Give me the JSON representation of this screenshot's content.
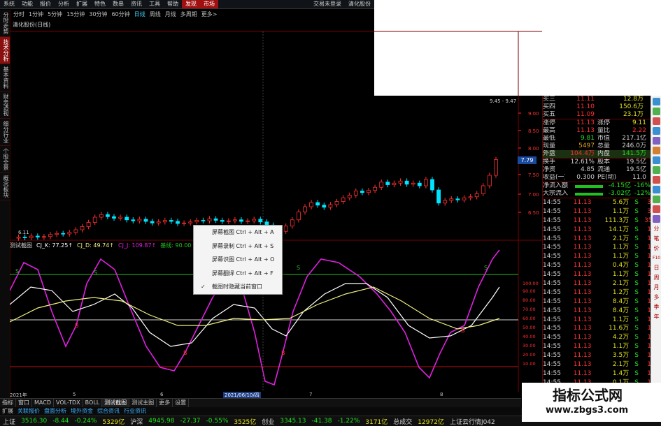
{
  "menubar": {
    "items": [
      "系统",
      "功能",
      "报价",
      "分析",
      "扩展",
      "特色",
      "数串",
      "资讯",
      "工具",
      "帮助"
    ],
    "highlight": [
      "发现",
      "市场"
    ],
    "right_items": [
      "交易未登录",
      "清化股份"
    ]
  },
  "toolbar": {
    "items": [
      "分时",
      "1分钟",
      "5分钟",
      "15分钟",
      "30分钟",
      "60分钟",
      "日线",
      "周线",
      "月线",
      "多周期",
      "更多>"
    ],
    "active": "日线"
  },
  "left_tabs": [
    "分时走势",
    "技术分析",
    "基本资料",
    "财务透视",
    "细分行业",
    "个股全景",
    "概念板块"
  ],
  "left_tab_active": "技术分析",
  "stock_title": "清化股份(日线)",
  "chart": {
    "upper_ticks": [
      "9.00",
      "8.50",
      "8.00",
      "7.50",
      "7.00",
      "6.50"
    ],
    "high_label": "9.45 - 9.47",
    "low_label": "6.11",
    "price_tag": "7.79",
    "lower_ticks": [
      "100.00",
      "90.00",
      "80.00",
      "70.00",
      "60.00",
      "50.00",
      "40.00",
      "30.00",
      "20.00",
      "10.00"
    ],
    "s_labels": [
      "S",
      "S",
      "S",
      "S",
      "S"
    ],
    "b_labels": [
      "B",
      "B",
      "B",
      "B",
      "B"
    ],
    "date_labels": [
      "2021年",
      "5",
      "6",
      "2021/06/10/四",
      "7",
      "8"
    ]
  },
  "indicator_bar": {
    "name": "测试截图",
    "k": "CJ_K: 77.25↑",
    "d": "CJ_D: 49.74↑",
    "j": "CJ_J: 109.87↑",
    "extra": "基线: 90.00"
  },
  "context_menu": {
    "items": [
      "屏幕截图 Ctrl + Alt + A",
      "屏幕录制 Ctrl + Alt + S",
      "屏幕识图 Ctrl + Alt + O",
      "屏幕翻译 Ctrl + Alt + F",
      "截图时隐藏当前窗口"
    ],
    "checked_index": 4
  },
  "quote": {
    "rows": [
      {
        "label": "买三",
        "value": "11.11",
        "side": "12.8万"
      },
      {
        "label": "买四",
        "value": "11.10",
        "side": "150.6万"
      },
      {
        "label": "买五",
        "value": "11.09",
        "side": "23.1万"
      }
    ],
    "stats": [
      {
        "l1": "涨停",
        "v1": "11.13",
        "l2": "涨停",
        "v2": "9.11"
      },
      {
        "l1": "最高",
        "v1": "11.13",
        "l2": "量比",
        "v2": "2.22"
      },
      {
        "l1": "最低",
        "v1": "9.81",
        "l2": "市值",
        "v2": "217.1亿"
      },
      {
        "l1": "现量",
        "v1": "5497",
        "l2": "总量",
        "v2": "246.0万"
      },
      {
        "l1": "外盘",
        "v1": "104.4万",
        "l2": "内盘",
        "v2": "141.5万"
      },
      {
        "l1": "换手",
        "v1": "12.61%",
        "l2": "股本",
        "v2": "19.5亿"
      },
      {
        "l1": "净资",
        "v1": "4.85",
        "l2": "流通",
        "v2": "19.5亿"
      },
      {
        "l1": "收益(一)",
        "v1": "0.300",
        "l2": "PE(动)",
        "v2": "11.0"
      }
    ],
    "flows": [
      {
        "label": "净流入额",
        "value": "-4.15亿",
        "pct": "-16%"
      },
      {
        "label": "大宗流入",
        "value": "-3.02亿",
        "pct": "-12%"
      }
    ]
  },
  "ticks": [
    {
      "t": "14:55",
      "p": "11.13",
      "v": "5.6万",
      "d": "S",
      "e": "3"
    },
    {
      "t": "14:55",
      "p": "11.13",
      "v": "1.1万",
      "d": "S",
      "e": "3"
    },
    {
      "t": "14:55",
      "p": "11.13",
      "v": "111.3万",
      "d": "S",
      "e": "35"
    },
    {
      "t": "14:55",
      "p": "11.13",
      "v": "14.1万",
      "d": "S",
      "e": "1"
    },
    {
      "t": "14:55",
      "p": "11.13",
      "v": "2.1万",
      "d": "S",
      "e": "1"
    },
    {
      "t": "14:55",
      "p": "11.13",
      "v": "1.1万",
      "d": "S",
      "e": "1"
    },
    {
      "t": "14:55",
      "p": "11.13",
      "v": "1.1万",
      "d": "S",
      "e": "1"
    },
    {
      "t": "14:55",
      "p": "11.13",
      "v": "0.4万",
      "d": "S",
      "e": "1"
    },
    {
      "t": "14:55",
      "p": "11.13",
      "v": "1.1万",
      "d": "S",
      "e": "1"
    },
    {
      "t": "14:55",
      "p": "11.13",
      "v": "2.1万",
      "d": "S",
      "e": "1"
    },
    {
      "t": "14:55",
      "p": "11.13",
      "v": "1.2万",
      "d": "S",
      "e": "1"
    },
    {
      "t": "14:55",
      "p": "11.13",
      "v": "8.4万",
      "d": "S",
      "e": "1"
    },
    {
      "t": "14:55",
      "p": "11.13",
      "v": "8.4万",
      "d": "S",
      "e": "1"
    },
    {
      "t": "14:55",
      "p": "11.13",
      "v": "1.1万",
      "d": "S",
      "e": "1"
    },
    {
      "t": "14:55",
      "p": "11.13",
      "v": "11.6万",
      "d": "S",
      "e": "1"
    },
    {
      "t": "14:55",
      "p": "11.13",
      "v": "4.2万",
      "d": "S",
      "e": "1"
    },
    {
      "t": "14:55",
      "p": "11.13",
      "v": "1.1万",
      "d": "S",
      "e": "1"
    },
    {
      "t": "14:55",
      "p": "11.13",
      "v": "3.5万",
      "d": "S",
      "e": "1"
    },
    {
      "t": "14:55",
      "p": "11.13",
      "v": "2.1万",
      "d": "S",
      "e": "1"
    },
    {
      "t": "14:55",
      "p": "11.13",
      "v": "1.4万",
      "d": "S",
      "e": "1"
    },
    {
      "t": "14:55",
      "p": "11.13",
      "v": "0.1万",
      "d": "S",
      "e": "1"
    }
  ],
  "right_sidebar": [
    "分",
    "笔",
    "价",
    "F10",
    "日",
    "周",
    "月",
    "多",
    "季",
    "年"
  ],
  "bottom_tabs": [
    "指标",
    "窗口",
    "MACD",
    "VOL-TDX",
    "BOLL",
    "测试截图",
    "测试主图",
    "更多",
    "设置"
  ],
  "bottom_active": "测试截图",
  "news_items": [
    "扩展",
    "关联报价",
    "盘面分析",
    "境外资金",
    "综合资讯",
    "行业资讯"
  ],
  "status": {
    "sh_label": "上证",
    "sh_value": "3516.30",
    "sh_chg": "-8.44",
    "sh_pct": "-0.24%",
    "sh_amt": "5329亿",
    "hs_label": "沪深",
    "hs_value": "4945.98",
    "hs_chg": "-27.37",
    "hs_pct": "-0.55%",
    "hs_amt": "3525亿",
    "cy_label": "创业",
    "cy_value": "3345.13",
    "cy_chg": "-41.38",
    "cy_pct": "-1.22%",
    "cy_amt": "3171亿",
    "total_label": "总成交",
    "total_value": "12972亿",
    "server": "上证云行情J042"
  },
  "watermark": {
    "line1": "指标公式网",
    "line2": "www.zbgs3.com"
  },
  "colors": {
    "up": "#ff3030",
    "down": "#00e5ff",
    "k_line": "#ffffff",
    "d_line": "#f0f080",
    "j_line": "#e020e0",
    "green_line": "#20c020",
    "red_line": "#c01010"
  }
}
